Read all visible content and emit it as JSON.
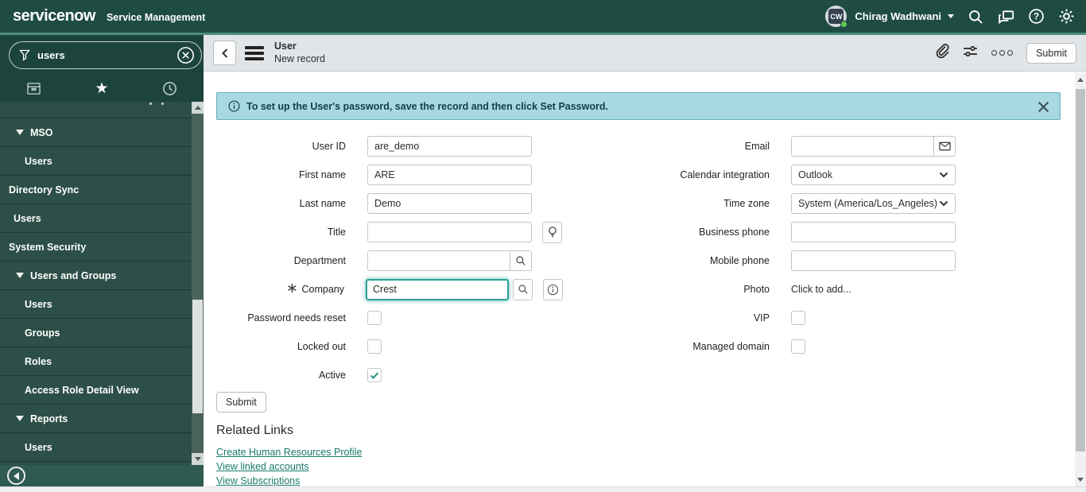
{
  "header": {
    "logo_text": "servicenow",
    "product": "Service Management",
    "user": {
      "initials": "CW",
      "name": "Chirag Wadhwani"
    }
  },
  "sidebar": {
    "filter_value": "users",
    "nav": [
      {
        "label": "MSO"
      },
      {
        "label": "Users"
      },
      {
        "label": "Directory Sync"
      },
      {
        "label": "Users"
      },
      {
        "label": "System Security"
      },
      {
        "label": "Users and Groups"
      },
      {
        "label": "Users"
      },
      {
        "label": "Groups"
      },
      {
        "label": "Roles"
      },
      {
        "label": "Access Role Detail View"
      },
      {
        "label": "Reports"
      },
      {
        "label": "Users"
      }
    ]
  },
  "form_header": {
    "title": "User",
    "subtitle": "New record",
    "submit_label": "Submit"
  },
  "banner": {
    "text": "To set up the User's password, save the record and then click Set Password."
  },
  "form": {
    "user_id": {
      "label": "User ID",
      "value": "are_demo"
    },
    "first_name": {
      "label": "First name",
      "value": "ARE"
    },
    "last_name": {
      "label": "Last name",
      "value": "Demo"
    },
    "title": {
      "label": "Title",
      "value": ""
    },
    "department": {
      "label": "Department",
      "value": ""
    },
    "company": {
      "label": "Company",
      "value": "Crest",
      "required": true
    },
    "password_needs_reset": {
      "label": "Password needs reset",
      "checked": false
    },
    "locked_out": {
      "label": "Locked out",
      "checked": false
    },
    "active": {
      "label": "Active",
      "checked": true
    },
    "email": {
      "label": "Email",
      "value": ""
    },
    "calendar_integration": {
      "label": "Calendar integration",
      "value": "Outlook"
    },
    "time_zone": {
      "label": "Time zone",
      "value": "System (America/Los_Angeles)"
    },
    "business_phone": {
      "label": "Business phone",
      "value": ""
    },
    "mobile_phone": {
      "label": "Mobile phone",
      "value": ""
    },
    "photo": {
      "label": "Photo",
      "value": "Click to add..."
    },
    "vip": {
      "label": "VIP",
      "checked": false
    },
    "managed_domain": {
      "label": "Managed domain",
      "checked": false
    }
  },
  "actions": {
    "submit_label": "Submit"
  },
  "related_links": {
    "heading": "Related Links",
    "links": [
      "Create Human Resources Profile",
      "View linked accounts",
      "View Subscriptions"
    ]
  },
  "colors": {
    "accent": "#4e8d7e",
    "banner_bg": "#a8d9e0",
    "link": "#1a7a6d",
    "focus": "#2aa198"
  }
}
